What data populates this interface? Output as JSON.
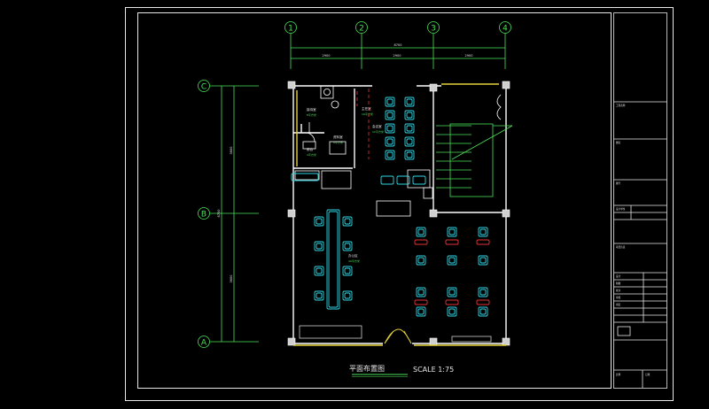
{
  "drawing": {
    "title": "平面布置图",
    "scale": "SCALE 1:75"
  },
  "grid": {
    "columns": [
      "1",
      "2",
      "3",
      "4"
    ],
    "rows": [
      "C",
      "B",
      "A"
    ],
    "overall_width": "8700",
    "bays": [
      "2900",
      "2900",
      "2900"
    ],
    "overall_depth": "8700",
    "row_bays": [
      "3600",
      "3600"
    ]
  },
  "rooms": [
    {
      "name": "主任室",
      "area": "10平方米"
    },
    {
      "name": "接待室",
      "area": "8平方米"
    },
    {
      "name": "会议室",
      "area": "12平方米"
    },
    {
      "name": "办公区",
      "area": "40平方米"
    },
    {
      "name": "资料室",
      "area": "9平方米"
    },
    {
      "name": "前台",
      "area": "4平方米"
    }
  ],
  "title_block": {
    "fields": [
      "工程名称",
      "图名",
      "图号",
      "设计单位",
      "项目负责",
      "设计",
      "制图",
      "校对",
      "审核",
      "审定",
      "比例",
      "日期"
    ]
  },
  "colors": {
    "frame": "#e8e8e8",
    "wall": "#ffffff",
    "furniture": "#32d6e6",
    "text_green": "#4be05a",
    "accent_yellow": "#e6d23c",
    "accent_red": "#e63232"
  }
}
